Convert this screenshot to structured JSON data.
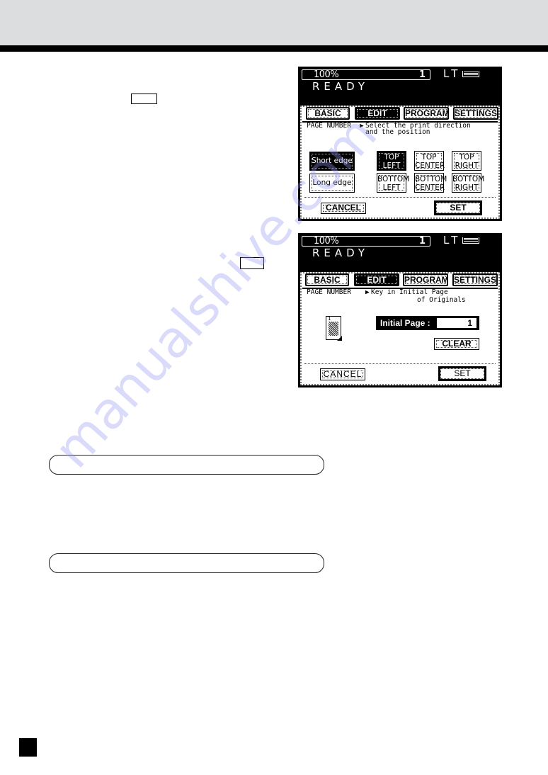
{
  "page": {
    "watermark": "manualshive.com"
  },
  "panel_direction": {
    "status": {
      "ratio": "100%",
      "copies": "1",
      "paper_size": "LT",
      "message": "READY"
    },
    "tabs": [
      {
        "label": "BASIC",
        "active": false
      },
      {
        "label": "EDIT",
        "active": true
      },
      {
        "label": "PROGRAM",
        "active": false
      },
      {
        "label": "SETTINGS",
        "active": false
      }
    ],
    "function_label": "PAGE NUMBER",
    "prompt_line1": "Select the print direction",
    "prompt_line2": "and the position",
    "direction_buttons": [
      {
        "label": "Short edge",
        "selected": true
      },
      {
        "label": "Long edge",
        "selected": false
      }
    ],
    "position_buttons": [
      {
        "line1": "TOP",
        "line2": "LEFT",
        "selected": true
      },
      {
        "line1": "TOP",
        "line2": "CENTER",
        "selected": false
      },
      {
        "line1": "TOP",
        "line2": "RIGHT",
        "selected": false
      },
      {
        "line1": "BOTTOM",
        "line2": "LEFT",
        "selected": false
      },
      {
        "line1": "BOTTOM",
        "line2": "CENTER",
        "selected": false
      },
      {
        "line1": "BOTTOM",
        "line2": "RIGHT",
        "selected": false
      }
    ],
    "cancel_label": "CANCEL",
    "set_label": "SET"
  },
  "panel_initial": {
    "status": {
      "ratio": "100%",
      "copies": "1",
      "paper_size": "LT",
      "message": "READY"
    },
    "tabs": [
      {
        "label": "BASIC",
        "active": false
      },
      {
        "label": "EDIT",
        "active": true
      },
      {
        "label": "PROGRAM",
        "active": false
      },
      {
        "label": "SETTINGS",
        "active": false
      }
    ],
    "function_label": "PAGE NUMBER",
    "prompt_line1": "Key in Initial Page",
    "prompt_line2": "of Originals",
    "doc_icon_number": "1",
    "initial_page_label": "Initial Page :",
    "initial_page_value": "1",
    "clear_label": "CLEAR",
    "cancel_label": "CANCEL",
    "set_label": "SET"
  }
}
